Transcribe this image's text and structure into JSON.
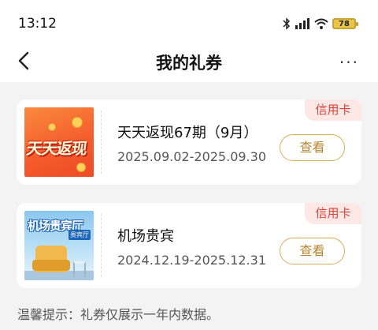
{
  "status_bar": {
    "time": "13:12",
    "battery": "78"
  },
  "header": {
    "title": "我的礼券",
    "more": "···"
  },
  "coupons": [
    {
      "tag": "信用卡",
      "name": "天天返现67期（9月）",
      "period": "2025.09.02-2025.09.30",
      "button": "查看",
      "thumb_text": "天天返现"
    },
    {
      "tag": "信用卡",
      "name": "机场贵宾",
      "period": "2024.12.19-2025.12.31",
      "button": "查看",
      "thumb_text": "机场贵宾厅",
      "thumb_badge": "贵宾厅"
    }
  ],
  "tip": "温馨提示：礼券仅展示一年内数据。",
  "colors": {
    "accent": "#b78733",
    "tag_text": "#d9423a",
    "tag_bg": "#fde8e5"
  }
}
